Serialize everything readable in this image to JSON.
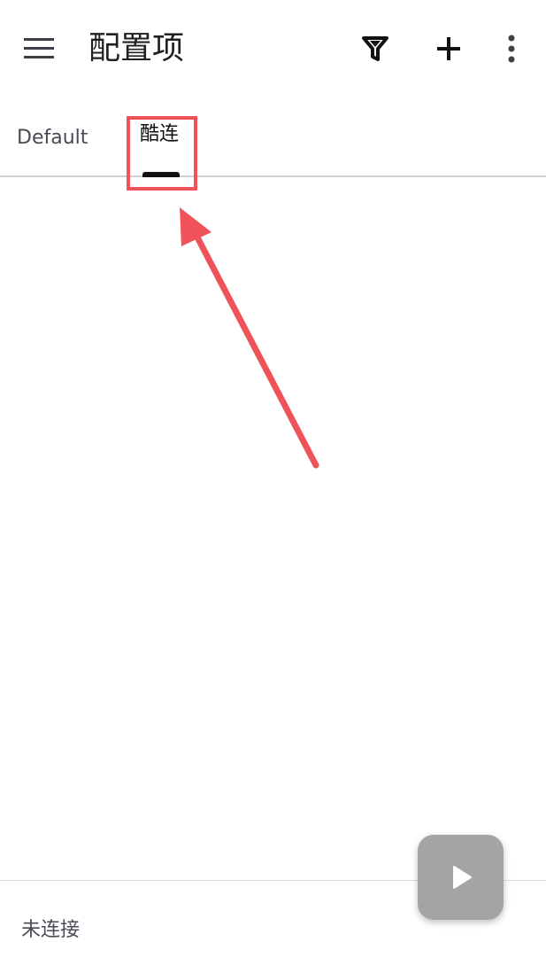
{
  "appbar": {
    "title": "配置项",
    "icons": {
      "menu": "menu-icon",
      "filter": "filter-icon",
      "add": "add-icon",
      "more": "more-vert-icon"
    }
  },
  "tabs": [
    {
      "label": "Default",
      "selected": false
    },
    {
      "label": "酷连",
      "selected": true
    }
  ],
  "status": {
    "text": "未连接"
  },
  "fab": {
    "icon": "play-icon"
  },
  "colors": {
    "annotation": "#f0525a",
    "fab_bg": "#a4a4a4",
    "tab_indicator": "#111111",
    "text_secondary": "#4a4a55"
  }
}
